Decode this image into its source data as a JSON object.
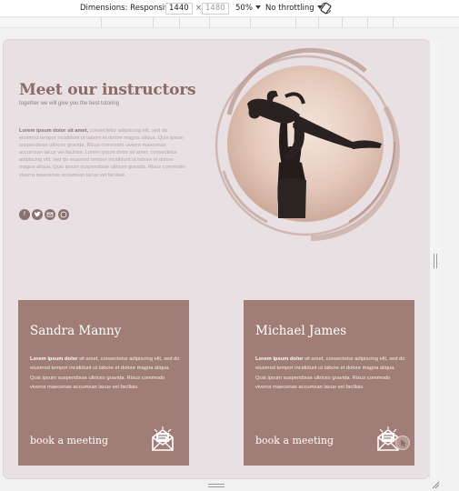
{
  "toolbar": {
    "dimensions_label": "Dimensions: Responsive",
    "width_value": "1440",
    "times_sign": "×",
    "height_value": "1480",
    "zoom": "50%",
    "throttling": "No throttling"
  },
  "page": {
    "title": "Meet our instructors",
    "subtitle": "together we will give you the best tutoring",
    "intro_lead": "Lorem ipsum dolor sit amet,",
    "intro_body": " consectetur adipiscing elit, sed do eiusmod tempor incididunt ut labore et dolore magna aliqua. Quis ipsum suspendisse ultrices gravida. Risus commodo viverra maecenas accumsan lacus vel facilisis. Lorem ipsum dolor sit amet, consectetur adipiscing elit, sed do eiusmod tempor incididunt ut labore et dolore magna aliqua. Quis ipsum suspendisse ultrices gravida. Risus commodo viverra maecenas accumsan lacus vel facilisis.",
    "social_icons": [
      "facebook-icon",
      "twitter-icon",
      "email-icon",
      "whatsapp-icon"
    ]
  },
  "instructors": [
    {
      "name": "Sandra Manny",
      "text_lead": "Lorem ipsum dolor",
      "text_body": " sit amet, consectetur adipiscing elit, sed do eiusmod tempor incididunt ut labore et dolore magna aliqua. Quis ipsum suspendisse ultrices gravida. Risus commodo viverra maecenas accumsan lacus vel facilisis.",
      "cta": "book a meeting"
    },
    {
      "name": "Michael James",
      "text_lead": "Lorem ipsum dolor",
      "text_body": " sit amet, consectetur adipiscing elit, sed do eiusmod tempor incididunt ut labore et dolore magna aliqua. Quis ipsum suspendisse ultrices gravida. Risus commodo viverra maecenas accumsan lacus vel facilisis.",
      "cta": "book a meeting"
    }
  ],
  "colors": {
    "page_bg": "#e8e0e3",
    "accent": "#8c6a66",
    "card_bg": "#a07e77"
  }
}
